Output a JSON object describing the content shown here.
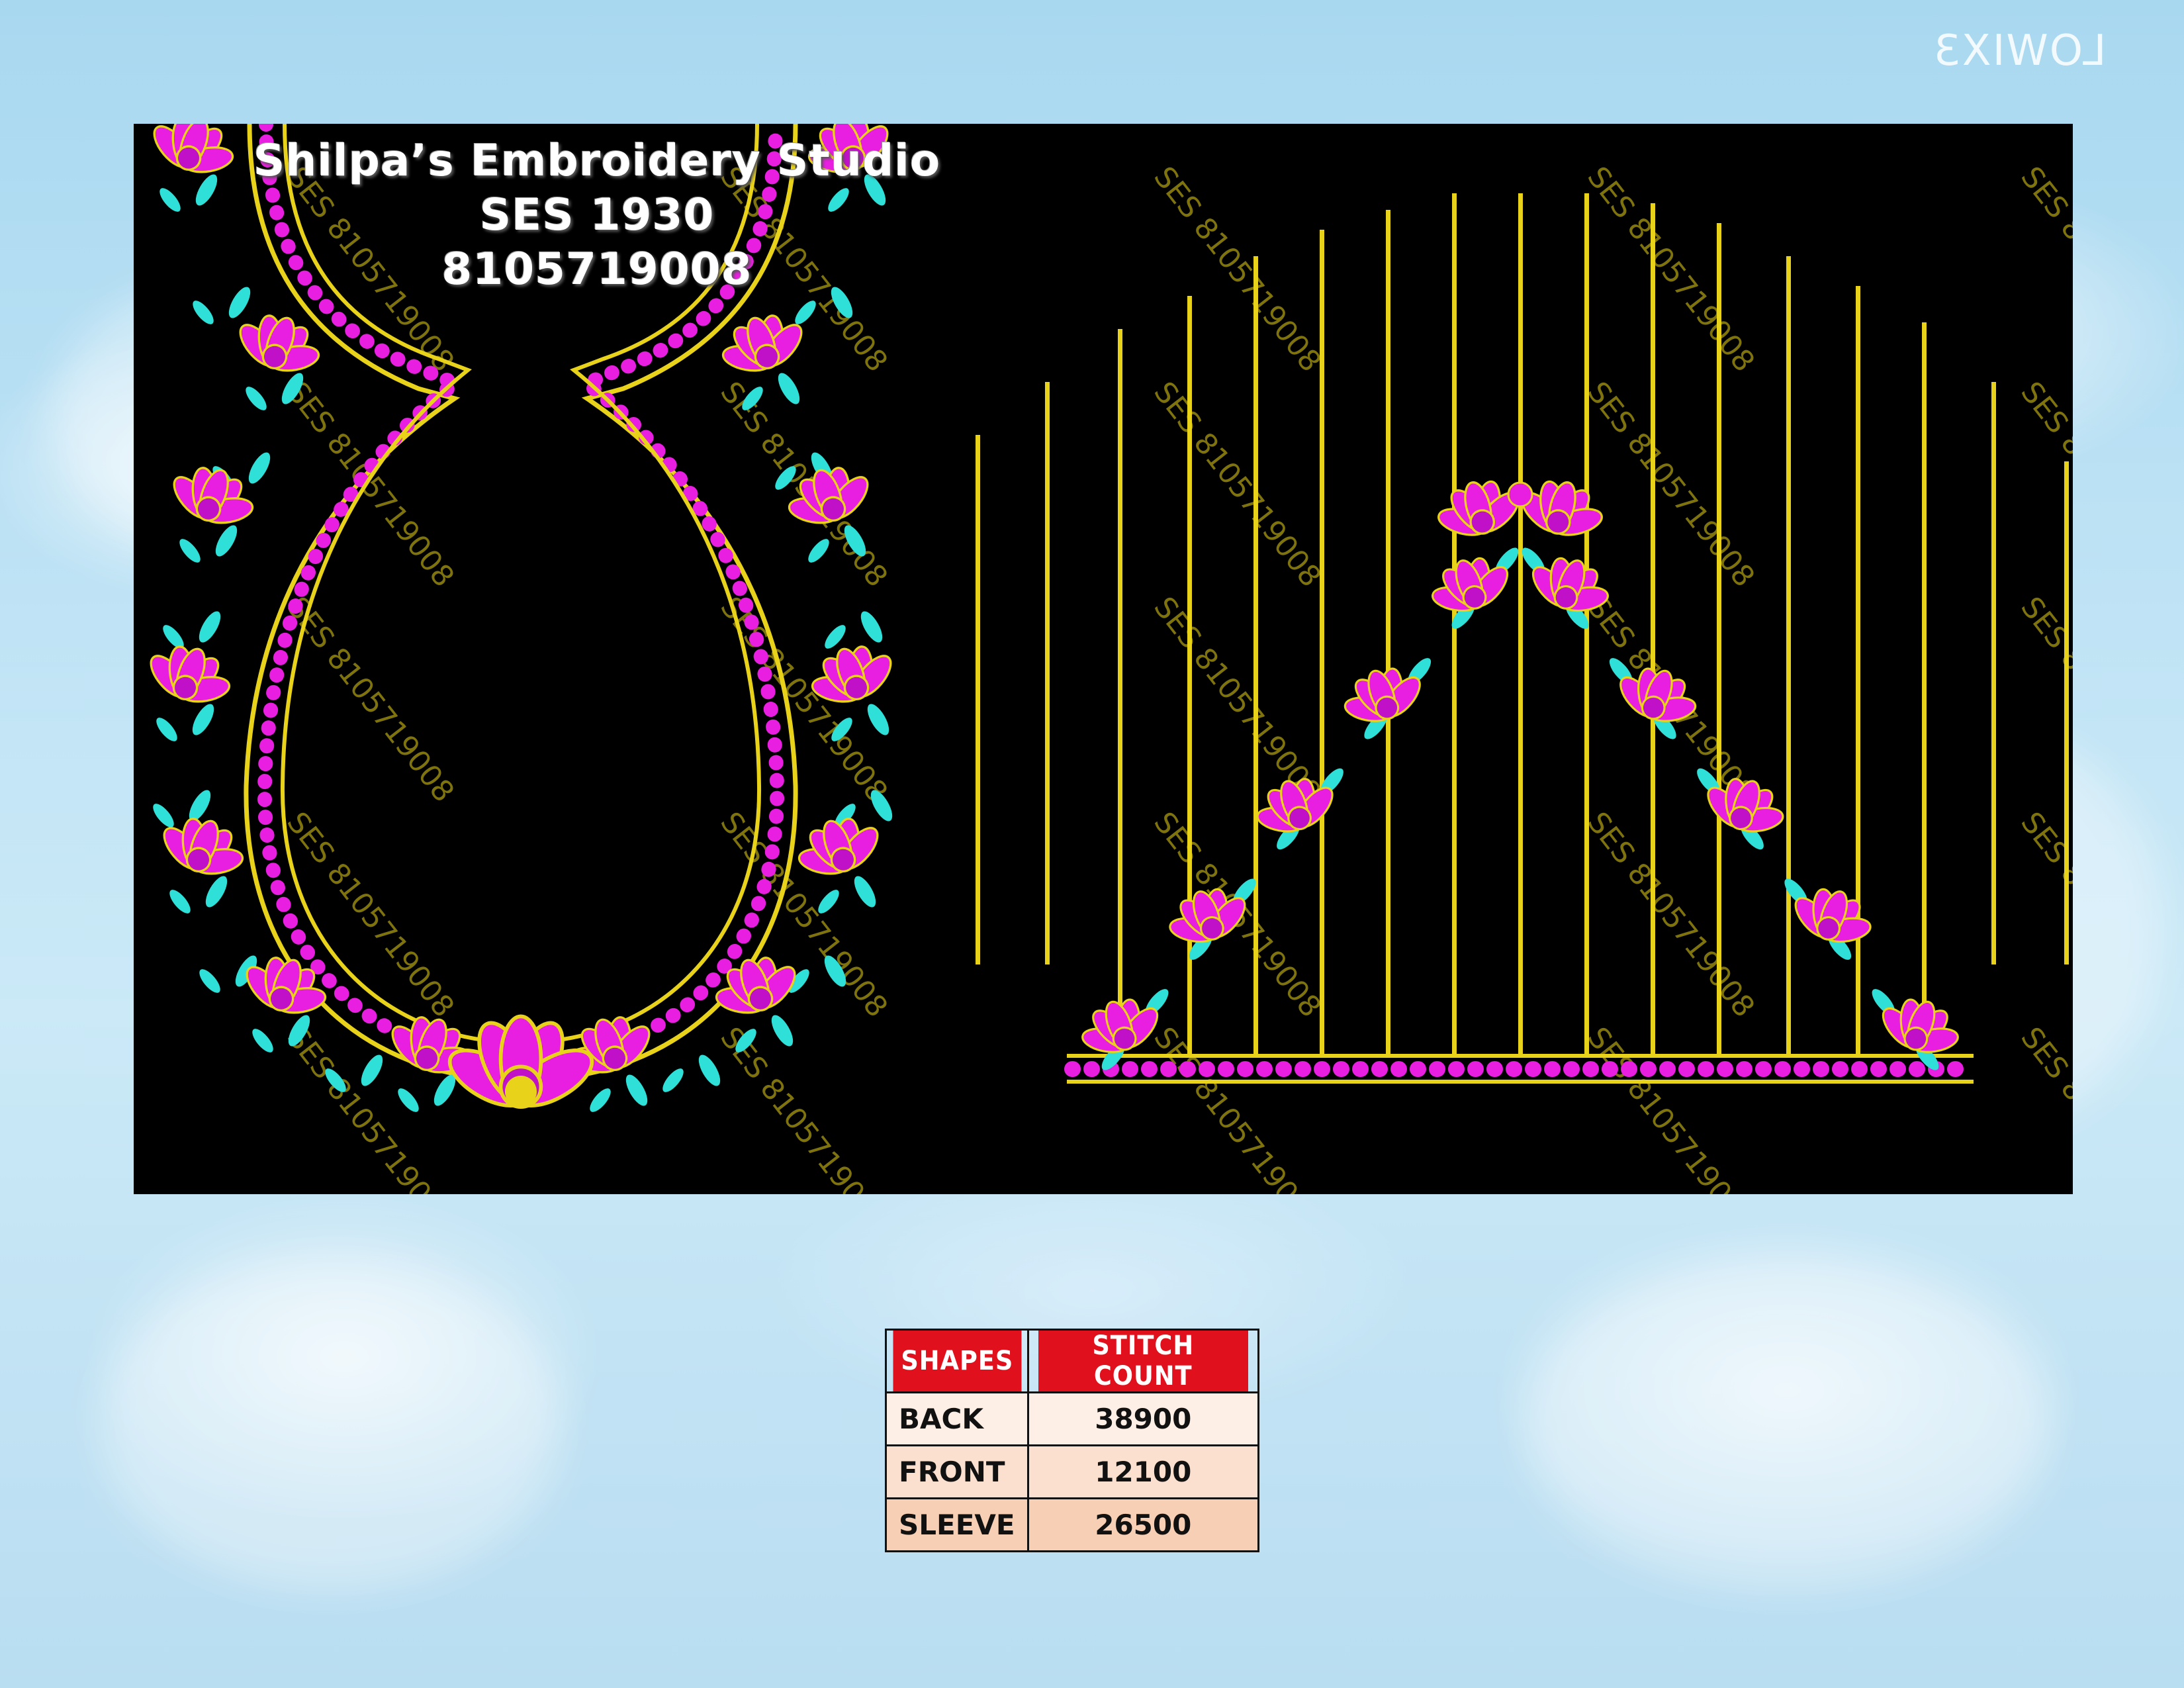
{
  "corner_logo": "LOWIX3",
  "studio": {
    "name": "Shilpa’s  Embroidery  Studio",
    "code": "SES  1930",
    "phone": "8105719008"
  },
  "watermark": "SES 8105719008",
  "colors": {
    "panel_bg": "#000000",
    "gold": "#e8d21a",
    "magenta": "#e81ee0",
    "teal": "#2ee0d8",
    "header_red": "#e0101c"
  },
  "stitch_table": {
    "headers": [
      "SHAPES",
      "STITCH COUNT"
    ],
    "rows": [
      {
        "shape": "BACK",
        "count": "38900"
      },
      {
        "shape": "FRONT",
        "count": "12100"
      },
      {
        "shape": "SLEEVE",
        "count": "26500"
      }
    ]
  }
}
